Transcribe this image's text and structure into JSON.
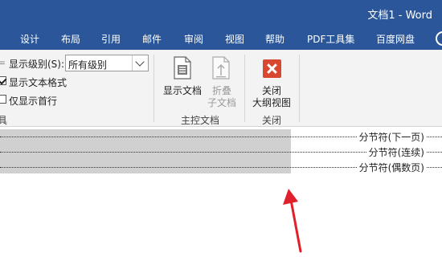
{
  "window": {
    "title": "文档1 - Word"
  },
  "tabs": [
    {
      "label": "设计"
    },
    {
      "label": "布局"
    },
    {
      "label": "引用"
    },
    {
      "label": "邮件"
    },
    {
      "label": "审阅"
    },
    {
      "label": "视图"
    },
    {
      "label": "帮助"
    },
    {
      "label": "PDF工具集"
    },
    {
      "label": "百度网盘"
    }
  ],
  "ribbon": {
    "outline_tools": {
      "show_level_label": "显示级别(S):",
      "show_level_value": "所有级别",
      "show_text_formatting": {
        "label": "显示文本格式",
        "checked": true
      },
      "show_first_line_only": {
        "label": "仅显示首行",
        "checked": false
      },
      "group_label_partial": "具"
    },
    "master_document": {
      "show_document_label": "显示文档",
      "collapse_subdocuments_line1": "折叠",
      "collapse_subdocuments_line2": "子文档",
      "group_label": "主控文档"
    },
    "close": {
      "close_button_line1": "关闭",
      "close_button_line2": "大纲视图",
      "group_label": "关闭"
    }
  },
  "document": {
    "section_breaks": [
      {
        "label": "分节符(下一页)"
      },
      {
        "label": "分节符(连续)"
      },
      {
        "label": "分节符(偶数页)"
      }
    ]
  },
  "colors": {
    "title_bar": "#2b579a",
    "ribbon_bg": "#f3f3f3",
    "close_icon": "#d8472f",
    "annotation_arrow": "#e0202a"
  },
  "icons": {
    "show_document": "document-icon",
    "collapse_subdocuments": "collapse-document-icon",
    "close_outline_view": "close-x-icon",
    "help": "lightbulb-icon"
  }
}
